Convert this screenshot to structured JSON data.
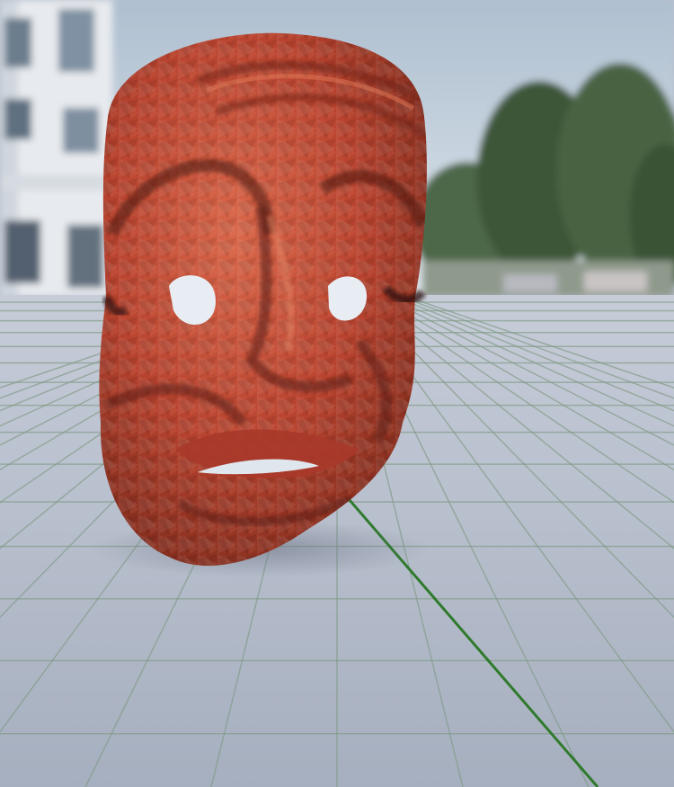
{
  "scene": {
    "subject": "carved-mask",
    "colors": {
      "sky_top": "#b8c6d6",
      "sky_bottom": "#dbe3ea",
      "building": "#e9ecef",
      "building_shadow": "#c4ccd4",
      "window": "#6d7f8f",
      "trees_dark": "#3d5437",
      "trees_mid": "#5a7252",
      "floor_near": "#a4adbe",
      "floor_far": "#c3c9d5",
      "grid_line": "#7f9a86",
      "axis_line": "#2f7a2c",
      "mask_base": "#b8432f",
      "mask_light": "#d9674a",
      "mask_dark": "#6f2418",
      "mask_shadow": "#4a160e",
      "eye_hole": "#e8edf3"
    },
    "icons": [
      "mask-icon"
    ]
  }
}
